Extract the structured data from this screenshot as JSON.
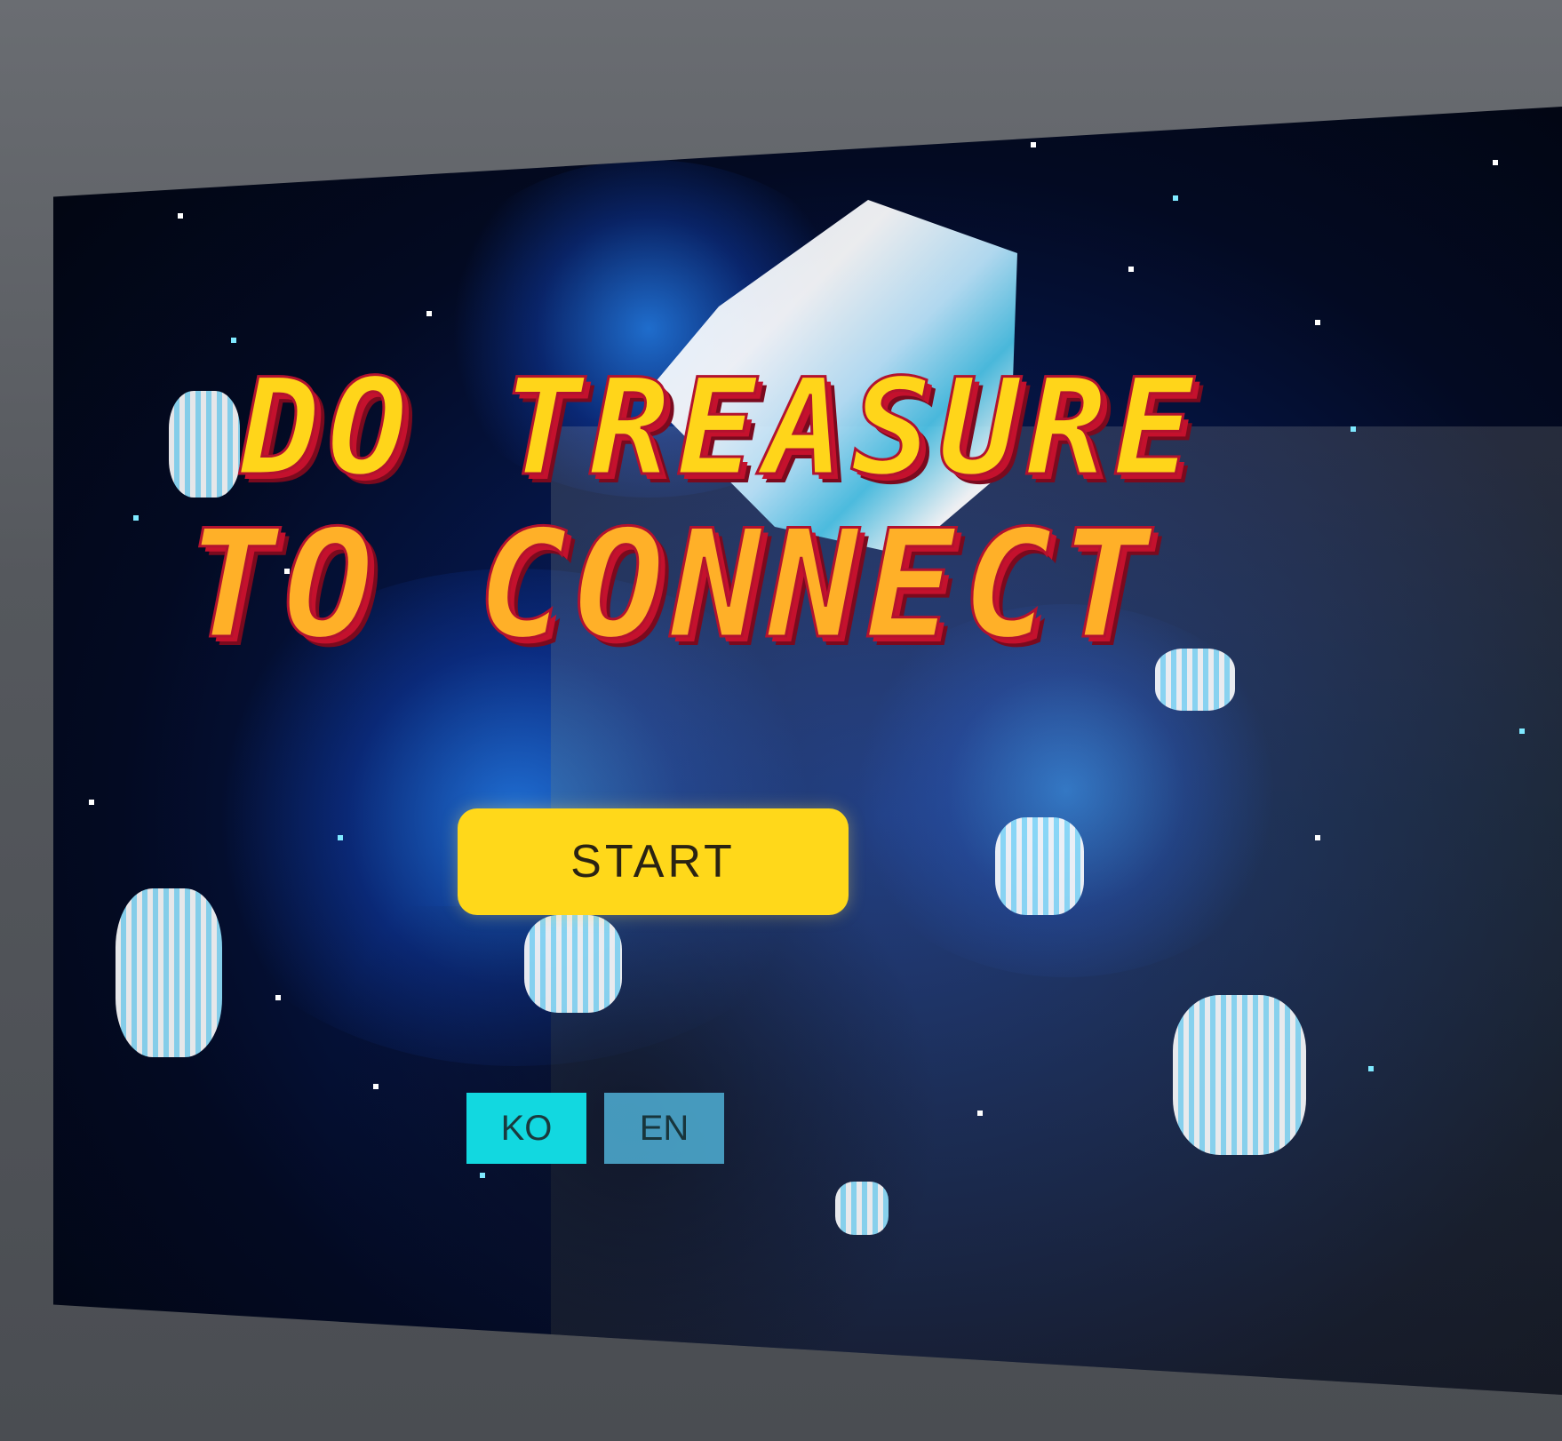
{
  "title": {
    "line1": "DO TREASURE",
    "line2": "TO CONNECT"
  },
  "buttons": {
    "start_label": "START",
    "lang_ko_label": "KO",
    "lang_en_label": "EN"
  },
  "colors": {
    "start_button": "#ffd81a",
    "lang_ko": "#12d8e0",
    "lang_en": "#4fb0d6",
    "title_yellow": "#ffd51a",
    "title_orange": "#ffb028",
    "title_outline": "#c4112d"
  },
  "icons": [
    "asteroid-sprite",
    "star-sprite"
  ]
}
